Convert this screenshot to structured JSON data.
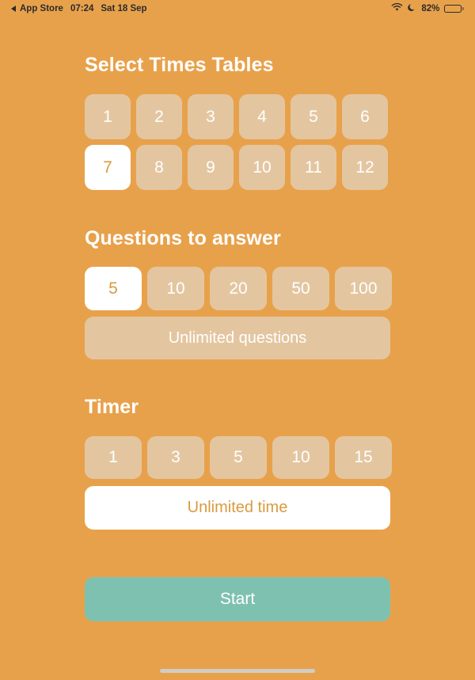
{
  "status_bar": {
    "back_label": "App Store",
    "back_icon": "back-triangle-icon",
    "time": "07:24",
    "date": "Sat 18 Sep",
    "wifi_icon": "wifi-icon",
    "dnd_icon": "moon-icon",
    "battery_percent": "82%",
    "battery_level": 82
  },
  "theme": {
    "background": "#e8a14b",
    "tile": "#e3c6a0",
    "tile_text": "#ffffff",
    "selected_bg": "#ffffff",
    "selected_text": "#d99b3e",
    "start_button": "#7ec1b0",
    "title_text": "#ffffff",
    "home_indicator": "#cfcdc8"
  },
  "sections": {
    "times_tables": {
      "title": "Select Times Tables",
      "rows": [
        [
          {
            "label": "1",
            "selected": false
          },
          {
            "label": "2",
            "selected": false
          },
          {
            "label": "3",
            "selected": false
          },
          {
            "label": "4",
            "selected": false
          },
          {
            "label": "5",
            "selected": false
          },
          {
            "label": "6",
            "selected": false
          }
        ],
        [
          {
            "label": "7",
            "selected": true
          },
          {
            "label": "8",
            "selected": false
          },
          {
            "label": "9",
            "selected": false
          },
          {
            "label": "10",
            "selected": false
          },
          {
            "label": "11",
            "selected": false
          },
          {
            "label": "12",
            "selected": false
          }
        ]
      ]
    },
    "questions": {
      "title": "Questions to answer",
      "options": [
        {
          "label": "5",
          "selected": true
        },
        {
          "label": "10",
          "selected": false
        },
        {
          "label": "20",
          "selected": false
        },
        {
          "label": "50",
          "selected": false
        },
        {
          "label": "100",
          "selected": false
        }
      ],
      "unlimited": {
        "label": "Unlimited questions",
        "selected": false
      }
    },
    "timer": {
      "title": "Timer",
      "options": [
        {
          "label": "1",
          "selected": false
        },
        {
          "label": "3",
          "selected": false
        },
        {
          "label": "5",
          "selected": false
        },
        {
          "label": "10",
          "selected": false
        },
        {
          "label": "15",
          "selected": false
        }
      ],
      "unlimited": {
        "label": "Unlimited time",
        "selected": true
      }
    }
  },
  "start": {
    "label": "Start"
  }
}
